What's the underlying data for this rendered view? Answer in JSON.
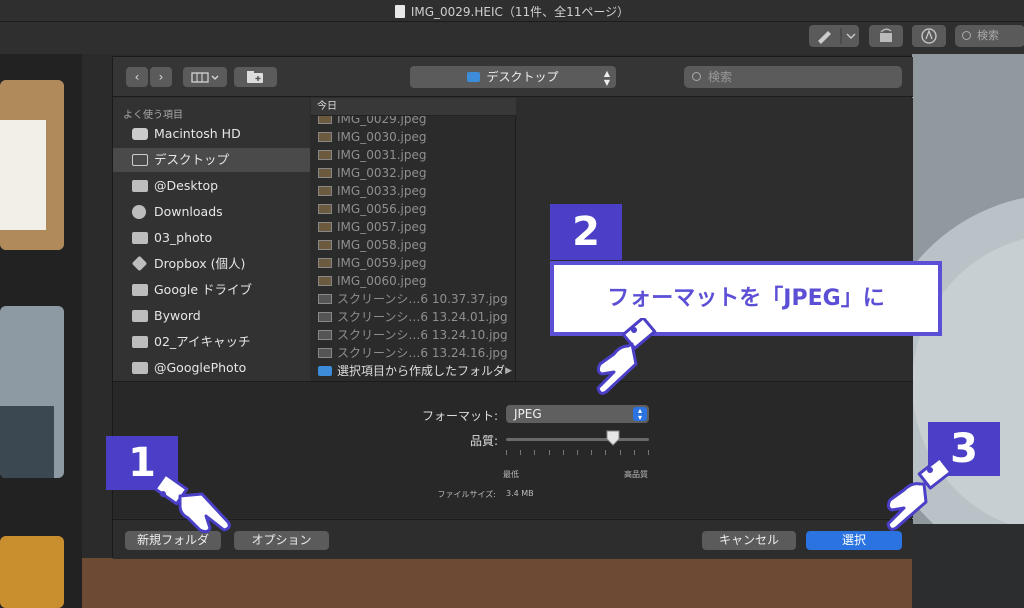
{
  "window": {
    "title": "IMG_0029.HEIC（11件、全11ページ）",
    "search_placeholder": "検索"
  },
  "dialog": {
    "location": "デスクトップ",
    "search_placeholder": "検索",
    "favorites_header": "よく使う項目",
    "favorites": [
      {
        "label": "Macintosh HD",
        "icon": "hard-drive-icon",
        "selected": false
      },
      {
        "label": "デスクトップ",
        "icon": "desktop-icon",
        "selected": true
      },
      {
        "label": "@Desktop",
        "icon": "folder-icon",
        "selected": false
      },
      {
        "label": "Downloads",
        "icon": "download-icon",
        "selected": false
      },
      {
        "label": "03_photo",
        "icon": "folder-icon",
        "selected": false
      },
      {
        "label": "Dropbox (個人)",
        "icon": "dropbox-icon",
        "selected": false
      },
      {
        "label": "Google ドライブ",
        "icon": "folder-icon",
        "selected": false
      },
      {
        "label": "Byword",
        "icon": "folder-icon",
        "selected": false
      },
      {
        "label": "02_アイキャッチ",
        "icon": "folder-icon",
        "selected": false
      },
      {
        "label": "@GooglePhoto",
        "icon": "folder-icon",
        "selected": false
      }
    ],
    "column_header": "今日",
    "files": [
      "IMG_0029.jpeg",
      "IMG_0030.jpeg",
      "IMG_0031.jpeg",
      "IMG_0032.jpeg",
      "IMG_0033.jpeg",
      "IMG_0056.jpeg",
      "IMG_0057.jpeg",
      "IMG_0058.jpeg",
      "IMG_0059.jpeg",
      "IMG_0060.jpeg",
      "スクリーンシ…6 10.37.37.jpg",
      "スクリーンシ…6 13.24.01.jpg",
      "スクリーンシ…6 13.24.10.jpg",
      "スクリーンシ…6 13.24.16.jpg",
      "選択項目から作成したフォルダ"
    ],
    "format_label": "フォーマット:",
    "format_value": "JPEG",
    "quality_label": "品質:",
    "quality_level": 0.75,
    "quality_min": "最低",
    "quality_max": "高品質",
    "filesize_label": "ファイルサイズ:",
    "filesize_value": "3.4 MB",
    "new_folder": "新規フォルダ",
    "options": "オプション",
    "cancel": "キャンセル",
    "select": "選択"
  },
  "annotations": {
    "step1": "1",
    "step2": "2",
    "step3": "3",
    "callout": "フォーマットを「JPEG」に",
    "accent": "#4a3fc6"
  }
}
